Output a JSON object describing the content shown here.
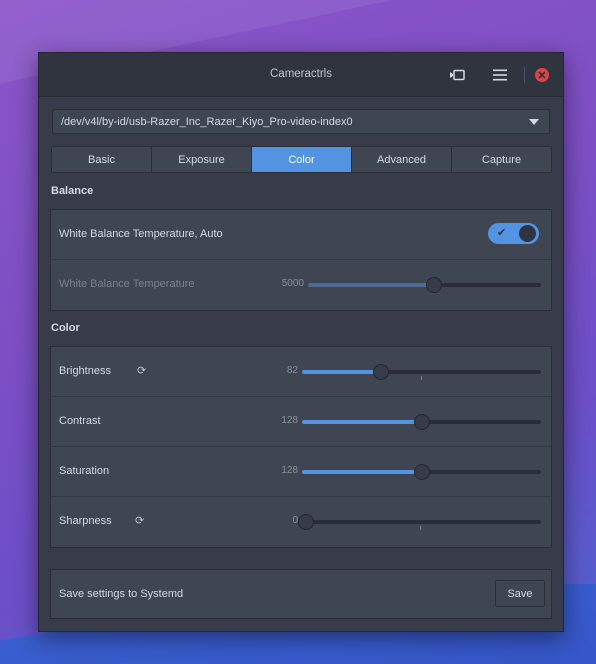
{
  "window": {
    "title": "Cameractrls"
  },
  "device": {
    "selected": "/dev/v4l/by-id/usb-Razer_Inc_Razer_Kiyo_Pro-video-index0"
  },
  "tabs": [
    {
      "label": "Basic",
      "active": false
    },
    {
      "label": "Exposure",
      "active": false
    },
    {
      "label": "Color",
      "active": true
    },
    {
      "label": "Advanced",
      "active": false
    },
    {
      "label": "Capture",
      "active": false
    }
  ],
  "balance": {
    "title": "Balance",
    "auto_label": "White Balance Temperature, Auto",
    "auto_on": true,
    "temp_label": "White Balance Temperature",
    "temp_value": "5000",
    "temp_fraction": 0.54
  },
  "color": {
    "title": "Color",
    "rows": [
      {
        "label": "Brightness",
        "value": "82",
        "fraction": 0.33,
        "reset": true
      },
      {
        "label": "Contrast",
        "value": "128",
        "fraction": 0.5,
        "reset": false
      },
      {
        "label": "Saturation",
        "value": "128",
        "fraction": 0.5,
        "reset": false
      },
      {
        "label": "Sharpness",
        "value": "0",
        "fraction": 0.0,
        "reset": true
      }
    ]
  },
  "save": {
    "label": "Save settings to Systemd",
    "button": "Save"
  },
  "colors": {
    "accent": "#5294e2",
    "window_bg": "#383c4a",
    "panel_bg": "#404552",
    "close": "#e14245"
  }
}
